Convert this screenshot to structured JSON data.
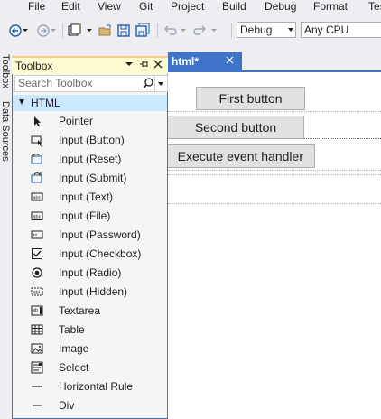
{
  "menu": [
    "File",
    "Edit",
    "View",
    "Git",
    "Project",
    "Build",
    "Debug",
    "Format",
    "Tes"
  ],
  "toolbar": {
    "config": "Debug",
    "platform": "Any CPU"
  },
  "side_tabs": [
    "Toolbox",
    "Data Sources"
  ],
  "toolbox": {
    "title": "Toolbox",
    "search_placeholder": "Search Toolbox",
    "category": "HTML",
    "items": [
      {
        "label": "Pointer",
        "icon": "pointer-icon"
      },
      {
        "label": "Input (Button)",
        "icon": "input-button-icon"
      },
      {
        "label": "Input (Reset)",
        "icon": "input-reset-icon"
      },
      {
        "label": "Input (Submit)",
        "icon": "input-submit-icon"
      },
      {
        "label": "Input (Text)",
        "icon": "input-text-icon"
      },
      {
        "label": "Input (File)",
        "icon": "input-file-icon"
      },
      {
        "label": "Input (Password)",
        "icon": "input-password-icon"
      },
      {
        "label": "Input (Checkbox)",
        "icon": "input-checkbox-icon"
      },
      {
        "label": "Input (Radio)",
        "icon": "input-radio-icon"
      },
      {
        "label": "Input (Hidden)",
        "icon": "input-hidden-icon"
      },
      {
        "label": "Textarea",
        "icon": "textarea-icon"
      },
      {
        "label": "Table",
        "icon": "table-icon"
      },
      {
        "label": "Image",
        "icon": "image-icon"
      },
      {
        "label": "Select",
        "icon": "select-icon"
      },
      {
        "label": "Horizontal Rule",
        "icon": "horizontal-rule-icon"
      },
      {
        "label": "Div",
        "icon": "div-icon"
      }
    ]
  },
  "document_tab": {
    "title": "html*",
    "close": "✕"
  },
  "designer": {
    "buttons": [
      "First button",
      "Second button",
      "Execute event handler"
    ]
  },
  "colors": {
    "accent": "#3d74c7",
    "selection": "#cce8ff",
    "header_active": "#fffbd0"
  }
}
